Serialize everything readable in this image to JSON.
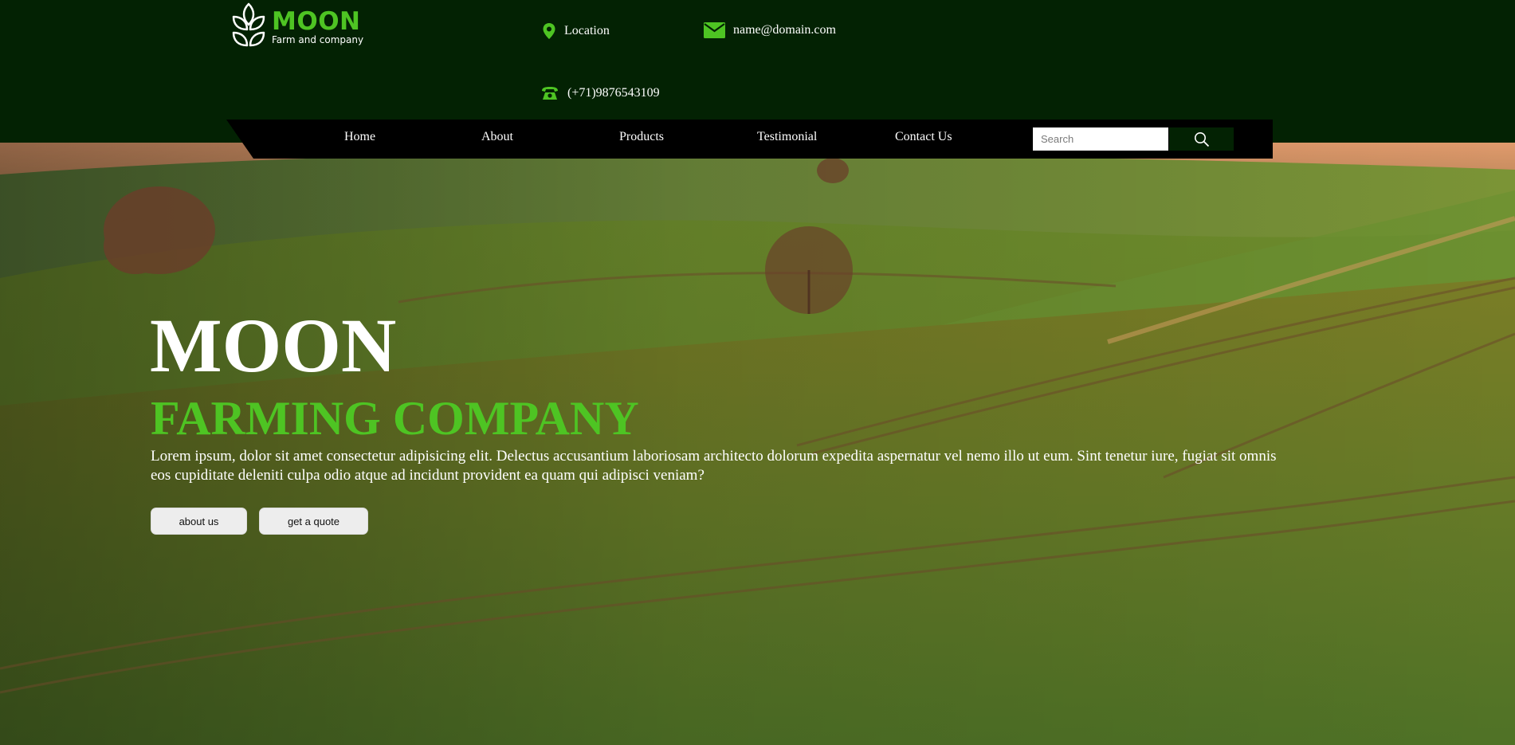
{
  "brand": {
    "name": "MOON",
    "tagline": "Farm and company",
    "icon": "leaf-logo-icon"
  },
  "contacts": {
    "location": {
      "icon": "location-pin-icon",
      "text": "Location"
    },
    "email": {
      "icon": "envelope-icon",
      "text": "name@domain.com"
    },
    "phone": {
      "icon": "telephone-icon",
      "text": "(+71)9876543109"
    }
  },
  "nav": {
    "items": [
      {
        "label": "Home"
      },
      {
        "label": "About"
      },
      {
        "label": "Products"
      },
      {
        "label": "Testimonial"
      },
      {
        "label": "Contact Us"
      }
    ],
    "search": {
      "placeholder": "Search",
      "value": "",
      "icon": "search-icon"
    }
  },
  "hero": {
    "title": "MOON",
    "subtitle": "FARMING COMPANY",
    "text": "Lorem ipsum, dolor sit amet consectetur adipisicing elit. Delectus accusantium laboriosam architecto dolorum expedita aspernatur vel nemo illo ut eum. Sint tenetur iure, fugiat sit omnis eos cupiditate deleniti culpa odio atque ad incidunt provident ea quam qui adipisci veniam?",
    "buttons": {
      "about": "about us",
      "quote": "get a quote"
    }
  },
  "colors": {
    "header_bg": "#032203",
    "accent_green": "#4ec423",
    "nav_bg": "#000000",
    "button_bg": "#ededed"
  }
}
